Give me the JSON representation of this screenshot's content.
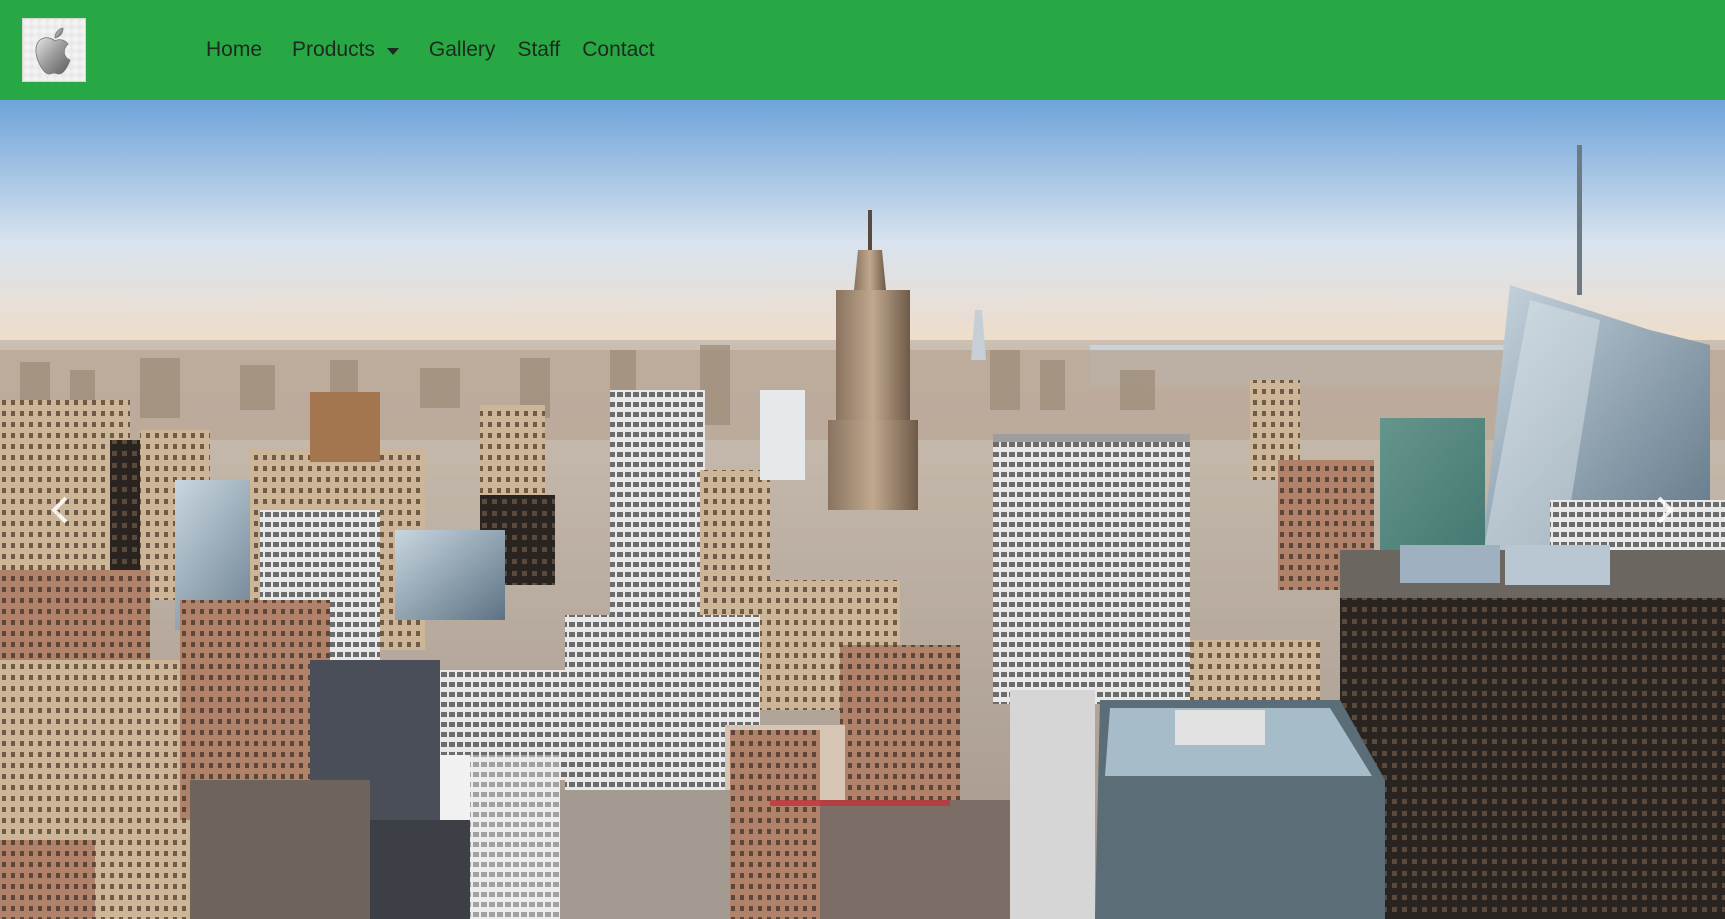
{
  "navbar": {
    "brand_icon": "apple-icon",
    "background_color": "#28a745",
    "links": [
      {
        "label": "Home"
      },
      {
        "label": "Products",
        "has_dropdown": true
      },
      {
        "label": "Gallery"
      },
      {
        "label": "Staff"
      },
      {
        "label": "Contact"
      }
    ]
  },
  "carousel": {
    "image": "new-york-skyline-photo",
    "prev_icon": "chevron-left-icon",
    "next_icon": "chevron-right-icon"
  }
}
